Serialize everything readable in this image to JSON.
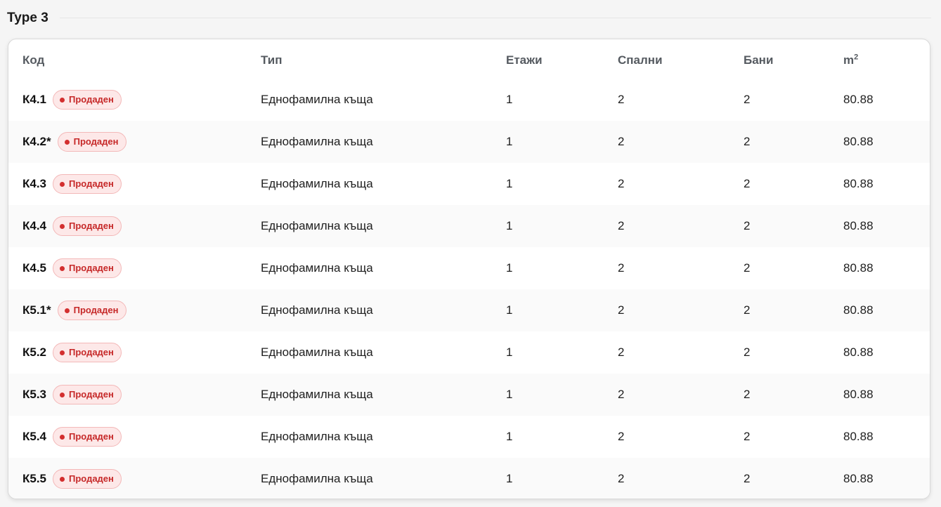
{
  "section": {
    "title": "Type 3"
  },
  "table": {
    "headers": {
      "code": "Код",
      "type": "Тип",
      "floors": "Етажи",
      "bedrooms": "Спални",
      "bathrooms": "Бани",
      "area_base": "m",
      "area_sup": "2"
    },
    "rows": [
      {
        "code": "К4.1",
        "status": "Продаден",
        "type": "Еднофамилна къща",
        "floors": "1",
        "bedrooms": "2",
        "bathrooms": "2",
        "area": "80.88"
      },
      {
        "code": "К4.2*",
        "status": "Продаден",
        "type": "Еднофамилна къща",
        "floors": "1",
        "bedrooms": "2",
        "bathrooms": "2",
        "area": "80.88"
      },
      {
        "code": "К4.3",
        "status": "Продаден",
        "type": "Еднофамилна къща",
        "floors": "1",
        "bedrooms": "2",
        "bathrooms": "2",
        "area": "80.88"
      },
      {
        "code": "К4.4",
        "status": "Продаден",
        "type": "Еднофамилна къща",
        "floors": "1",
        "bedrooms": "2",
        "bathrooms": "2",
        "area": "80.88"
      },
      {
        "code": "К4.5",
        "status": "Продаден",
        "type": "Еднофамилна къща",
        "floors": "1",
        "bedrooms": "2",
        "bathrooms": "2",
        "area": "80.88"
      },
      {
        "code": "К5.1*",
        "status": "Продаден",
        "type": "Еднофамилна къща",
        "floors": "1",
        "bedrooms": "2",
        "bathrooms": "2",
        "area": "80.88"
      },
      {
        "code": "К5.2",
        "status": "Продаден",
        "type": "Еднофамилна къща",
        "floors": "1",
        "bedrooms": "2",
        "bathrooms": "2",
        "area": "80.88"
      },
      {
        "code": "К5.3",
        "status": "Продаден",
        "type": "Еднофамилна къща",
        "floors": "1",
        "bedrooms": "2",
        "bathrooms": "2",
        "area": "80.88"
      },
      {
        "code": "К5.4",
        "status": "Продаден",
        "type": "Еднофамилна къща",
        "floors": "1",
        "bedrooms": "2",
        "bathrooms": "2",
        "area": "80.88"
      },
      {
        "code": "К5.5",
        "status": "Продаден",
        "type": "Еднофамилна къща",
        "floors": "1",
        "bedrooms": "2",
        "bathrooms": "2",
        "area": "80.88"
      }
    ]
  },
  "colors": {
    "badge_text": "#c62828",
    "badge_bg": "#fde8e8",
    "badge_border": "#f3b8b8",
    "row_alt": "#fafafa"
  }
}
